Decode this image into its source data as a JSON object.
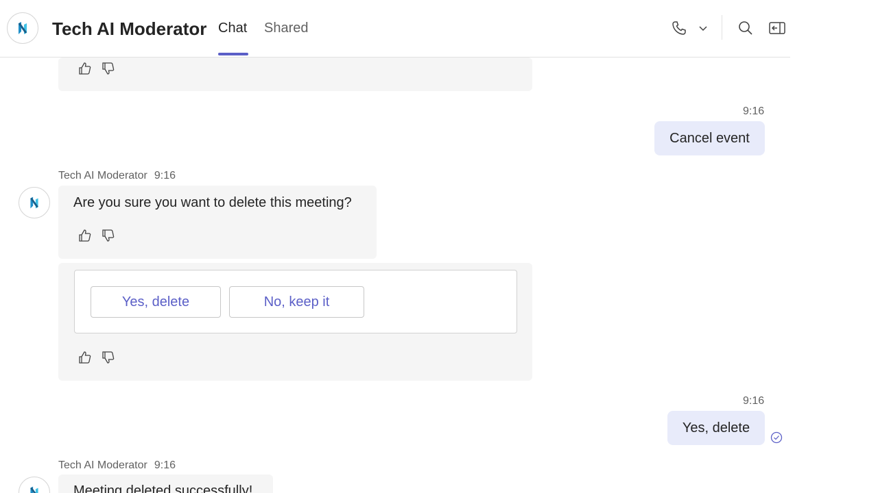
{
  "header": {
    "title": "Tech AI Moderator",
    "tabs": [
      {
        "label": "Chat",
        "active": true
      },
      {
        "label": "Shared",
        "active": false
      }
    ],
    "icons": [
      "app-logo-icon",
      "phone-icon",
      "chevron-down-icon",
      "search-icon",
      "panel-toggle-icon"
    ]
  },
  "colors": {
    "accent": "#5b5fc7",
    "bot_bubble": "#f5f5f5",
    "user_bubble": "#e8ebfa"
  },
  "messages": [
    {
      "sender": "user",
      "time": "9:16",
      "text": "Cancel event"
    },
    {
      "sender": "bot",
      "name": "Tech AI Moderator",
      "time": "9:16",
      "text": "Are you sure you want to delete this meeting?"
    },
    {
      "sender": "bot-card",
      "buttons": [
        {
          "label": "Yes, delete"
        },
        {
          "label": "No, keep it"
        }
      ]
    },
    {
      "sender": "user",
      "time": "9:16",
      "text": "Yes, delete",
      "status": "read"
    },
    {
      "sender": "bot",
      "name": "Tech AI Moderator",
      "time": "9:16",
      "text": "Meeting deleted successfully!"
    }
  ]
}
